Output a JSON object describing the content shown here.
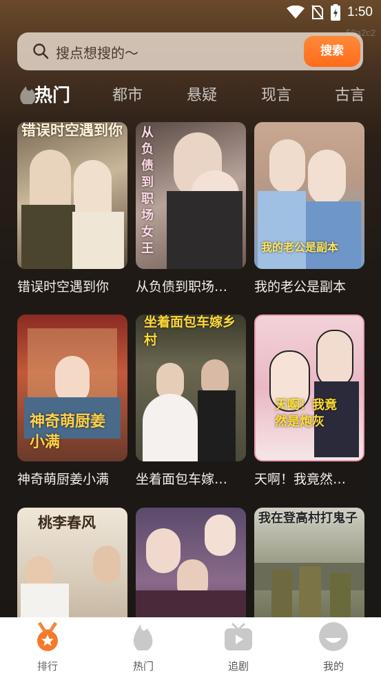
{
  "status_bar": {
    "time": "1:50"
  },
  "watermark": "59a2c2",
  "search": {
    "placeholder": "搜点想搜的～",
    "button_label": "搜索"
  },
  "tabs": [
    {
      "label": "热门",
      "active": true
    },
    {
      "label": "都市"
    },
    {
      "label": "悬疑"
    },
    {
      "label": "现言"
    },
    {
      "label": "古言"
    }
  ],
  "dramas": [
    {
      "title": "错误时空遇到你",
      "poster_text": "错误时空遇到你"
    },
    {
      "title": "从负债到职场…",
      "poster_text": "从负债到职场女王"
    },
    {
      "title": "我的老公是副本",
      "poster_text": "我的老公是副本"
    },
    {
      "title": "神奇萌厨姜小满",
      "poster_text": "神奇萌厨姜小满"
    },
    {
      "title": "坐着面包车嫁…",
      "poster_text": "坐着面包车嫁乡村"
    },
    {
      "title": "天啊！我竟然…",
      "poster_text": "天啊！我竟然是炮灰"
    },
    {
      "title": "",
      "poster_text": "桃李春风"
    },
    {
      "title": "",
      "poster_text": ""
    },
    {
      "title": "",
      "poster_text": "我在登高村打鬼子"
    }
  ],
  "bottom_nav": [
    {
      "label": "排行",
      "icon": "medal-icon",
      "active": true
    },
    {
      "label": "热门",
      "icon": "flame-icon"
    },
    {
      "label": "追剧",
      "icon": "tv-play-icon"
    },
    {
      "label": "我的",
      "icon": "profile-icon"
    }
  ],
  "colors": {
    "accent": "#ff6b1a",
    "card_title": "#f2eee9"
  }
}
